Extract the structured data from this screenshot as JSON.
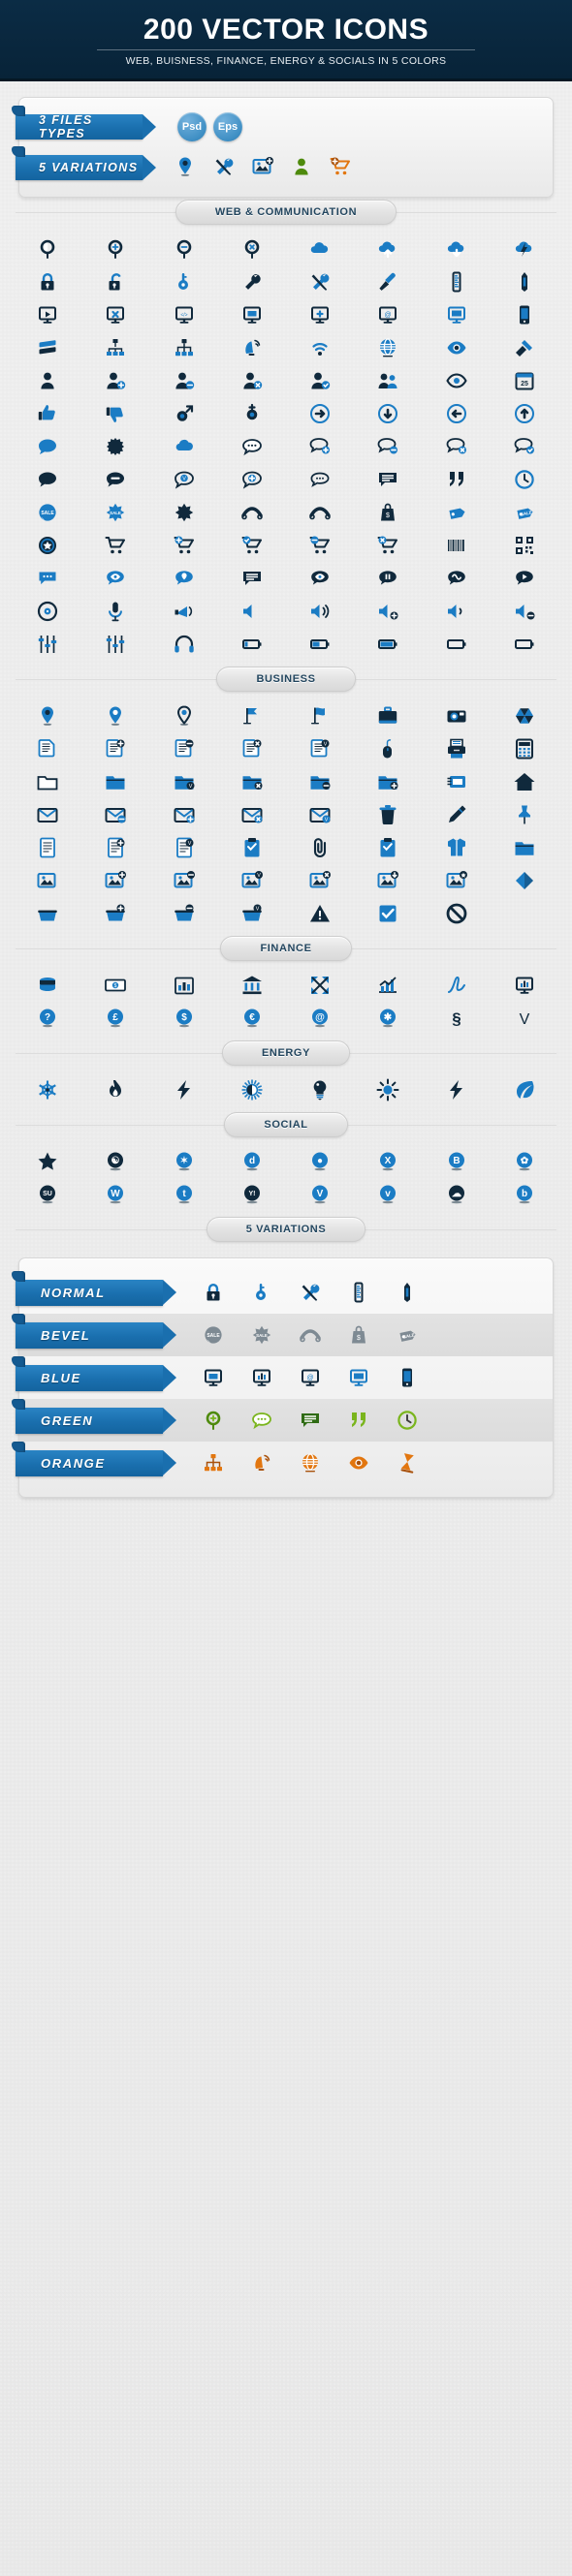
{
  "banner": {
    "title": "200 VECTOR ICONS",
    "subtitle": "WEB, BUISNESS, FINANCE, ENERGY & SOCIALS IN 5 COLORS"
  },
  "info_panel": {
    "rows": [
      {
        "label": "3 FILES TYPES",
        "type": "chips",
        "chips": [
          "Psd",
          "Eps"
        ]
      },
      {
        "label": "5 VARIATIONS",
        "type": "icons",
        "icons": [
          "map-pin-icon",
          "tools-icon",
          "image-add-icon",
          "user-verified-icon",
          "cart-add-icon"
        ]
      }
    ]
  },
  "sections": [
    {
      "id": "web",
      "title": "WEB & COMMUNICATION",
      "columns": 8,
      "rows": [
        [
          "magnifier-icon",
          "magnifier-plus-icon",
          "magnifier-minus-icon",
          "magnifier-close-icon",
          "cloud-icon",
          "cloud-upload-icon",
          "cloud-download-icon",
          "cloud-flash-icon"
        ],
        [
          "lock-closed-icon",
          "lock-open-icon",
          "key-icon",
          "wrench-icon",
          "tools-icon",
          "screwdriver-icon",
          "ruler-icon",
          "pen-icon"
        ],
        [
          "monitor-play-icon",
          "monitor-close-icon",
          "monitor-code-icon",
          "monitor-window-icon",
          "monitor-add-icon",
          "monitor-at-icon",
          "monitor-blue-icon",
          "smartphone-icon"
        ],
        [
          "server-icon",
          "network-icon",
          "sitemap-icon",
          "satellite-dish-icon",
          "wifi-icon",
          "globe-icon",
          "eye-icon",
          "satellite-icon"
        ],
        [
          "user-icon",
          "user-add-icon",
          "user-remove-icon",
          "user-close-icon",
          "user-check-icon",
          "users-group-icon",
          "eye-outline-icon",
          "calendar-25-icon"
        ],
        [
          "thumbs-up-icon",
          "thumbs-down-icon",
          "male-symbol-icon",
          "female-symbol-icon",
          "arrow-right-circle-icon",
          "arrow-down-circle-icon",
          "arrow-left-circle-icon",
          "arrow-up-circle-icon"
        ],
        [
          "speech-bubble-icon",
          "burst-bubble-icon",
          "cloud-bubble-icon",
          "chat-bubble-icon",
          "chat-add-icon",
          "chat-remove-icon",
          "chat-close-icon",
          "chat-check-icon"
        ],
        [
          "bubble-filled-icon",
          "bubble-minus-icon",
          "bubble-check-icon",
          "bubble-plus-icon",
          "bubble-dots-icon",
          "comment-lines-icon",
          "quote-icon",
          "clock-icon"
        ],
        [
          "sticker-sale-icon",
          "starburst-sale-icon",
          "starburst-icon",
          "ribbon-banner-icon",
          "ribbon-curve-icon",
          "price-bag-icon",
          "price-tag-icon",
          "price-tag-sale-icon"
        ],
        [
          "badge-star-icon",
          "cart-icon",
          "cart-add-icon",
          "cart-check-icon",
          "cart-remove-icon",
          "cart-close-icon",
          "barcode-icon",
          "qrcode-icon"
        ],
        [
          "chat-dots-icon",
          "eye-bubble-icon",
          "location-bubble-icon",
          "chat-solid-icon",
          "eye-solid-bubble-icon",
          "pause-bubble-icon",
          "wave-bubble-icon",
          "play-bubble-icon"
        ],
        [
          "disc-icon",
          "microphone-icon",
          "megaphone-icon",
          "speaker-icon",
          "volume-up-icon",
          "volume-add-icon",
          "volume-down-icon",
          "volume-mute-icon"
        ],
        [
          "equalizer-icon",
          "sliders-icon",
          "headphones-icon",
          "battery-low-icon",
          "battery-half-icon",
          "battery-full-icon",
          "battery-empty-icon",
          "battery-outline-icon"
        ]
      ]
    },
    {
      "id": "business",
      "title": "BUSINESS",
      "columns": 8,
      "rows": [
        [
          "map-pin-icon",
          "map-pin-filled-icon",
          "map-pin-outline-icon",
          "flag-pennant-icon",
          "flag-icon",
          "briefcase-icon",
          "camera-icon",
          "aperture-icon"
        ],
        [
          "document-icon",
          "document-add-icon",
          "document-remove-icon",
          "document-close-icon",
          "document-check-icon",
          "mouse-icon",
          "printer-icon",
          "calculator-icon"
        ],
        [
          "folder-open-icon",
          "folder-icon",
          "folder-check-icon",
          "folder-close-icon",
          "folder-remove-icon",
          "folder-add-icon",
          "card-index-icon",
          "home-icon"
        ],
        [
          "envelope-icon",
          "envelope-remove-icon",
          "envelope-add-icon",
          "envelope-close-icon",
          "envelope-check-icon",
          "trash-icon",
          "pen-nib-icon",
          "pushpin-icon"
        ],
        [
          "notebook-icon",
          "notebook-add-icon",
          "notebook-check-icon",
          "clipboard-check-icon",
          "paperclip-icon",
          "clipboard-icon",
          "shirt-icon",
          "folder-tab-icon"
        ],
        [
          "image-icon",
          "image-add-icon",
          "image-remove-icon",
          "image-check-icon",
          "image-close-icon",
          "image-download-icon",
          "image-star-icon",
          "diamond-icon"
        ],
        [
          "basket-icon",
          "basket-add-icon",
          "basket-remove-icon",
          "basket-check-icon",
          "warning-icon",
          "checkbox-icon",
          "forbidden-icon",
          ""
        ]
      ]
    },
    {
      "id": "finance",
      "title": "FINANCE",
      "columns": 8,
      "rows": [
        [
          "coins-icon",
          "banknote-icon",
          "bar-chart-icon",
          "bank-icon",
          "arrows-expand-icon",
          "growth-chart-icon",
          "signature-icon",
          "monitor-chart-icon"
        ],
        [
          "question-coin-icon",
          "pound-coin-icon",
          "dollar-coin-icon",
          "euro-coin-icon",
          "at-coin-icon",
          "asterisk-coin-icon",
          "section-sign-icon",
          "checkmark-v-icon"
        ]
      ]
    },
    {
      "id": "energy",
      "title": "ENERGY",
      "columns": 8,
      "rows": [
        [
          "snowflake-icon",
          "flame-icon",
          "bolt-icon",
          "contrast-sun-icon",
          "lightbulb-icon",
          "sun-icon",
          "lightning-icon",
          "leaf-icon"
        ]
      ]
    },
    {
      "id": "social",
      "title": "SOCIAL",
      "columns": 8,
      "rows": [
        [
          "star-icon",
          "feedburner-icon",
          "flickr-icon",
          "digg-icon",
          "dribbble-icon",
          "xing-icon",
          "behance-icon",
          "picasa-icon"
        ],
        [
          "stumbleupon-icon",
          "wordpress-icon",
          "technorati-icon",
          "yahoo-icon",
          "vimeo-icon",
          "viadeo-icon",
          "cloudapp-icon",
          "blogger-icon"
        ]
      ]
    }
  ],
  "variations": {
    "title": "5 VARIATIONS",
    "rows": [
      {
        "label": "NORMAL",
        "shaded": false,
        "style": "normal",
        "icons": [
          "lock-closed-icon",
          "key-icon",
          "tools-icon",
          "ruler-icon",
          "pencil-icon"
        ]
      },
      {
        "label": "BEVEL",
        "shaded": true,
        "style": "bevel",
        "icons": [
          "sticker-sale-icon",
          "starburst-sale-icon",
          "ribbon-curve-icon",
          "price-bag-icon",
          "price-tag-sale-icon"
        ]
      },
      {
        "label": "BLUE",
        "shaded": false,
        "style": "blue",
        "icons": [
          "monitor-window-icon",
          "monitor-chart-icon",
          "monitor-at-icon",
          "monitor-blue-icon",
          "smartphone-icon"
        ]
      },
      {
        "label": "GREEN",
        "shaded": true,
        "style": "green",
        "icons": [
          "magnifier-plus-icon",
          "chat-bubble-icon",
          "comment-lines-icon",
          "quote-icon",
          "clock-icon"
        ]
      },
      {
        "label": "ORANGE",
        "shaded": false,
        "style": "orange",
        "icons": [
          "sitemap-icon",
          "satellite-dish-icon",
          "globe-icon",
          "eye-icon",
          "hourglass-icon"
        ]
      }
    ]
  },
  "colors": {
    "banner_bg": "#0b2c45",
    "accent_blue": "#1a6fae",
    "icon_blue": "#1b7cc4",
    "icon_dark": "#10293c",
    "green": "#7ab51d",
    "orange": "#e2760f",
    "bevel_gray": "#7e8a93",
    "panel_bg": "#efefef"
  }
}
